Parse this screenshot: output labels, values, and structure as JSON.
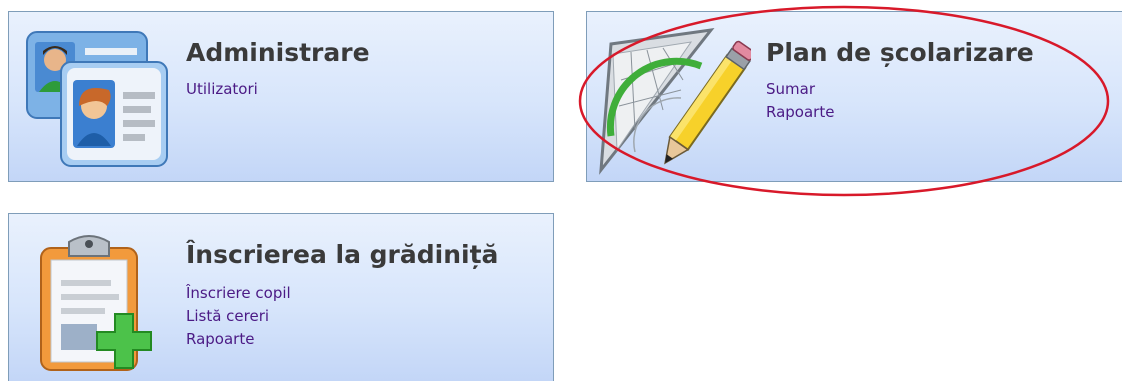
{
  "tiles": {
    "admin": {
      "title": "Administrare",
      "links": [
        "Utilizatori"
      ],
      "icon": "user-id-cards-icon"
    },
    "plan": {
      "title": "Plan de școlarizare",
      "links": [
        "Sumar",
        "Rapoarte"
      ],
      "icon": "protractor-pencil-icon"
    },
    "inscriere": {
      "title": "Înscrierea la grădiniță",
      "links": [
        "Înscriere copil",
        "Listă cereri",
        "Rapoarte"
      ],
      "icon": "clipboard-add-icon"
    }
  },
  "colors": {
    "link": "#4b1a85",
    "title": "#3a3a3a",
    "tile_border": "#7f9db9",
    "highlight": "#d8192a"
  }
}
